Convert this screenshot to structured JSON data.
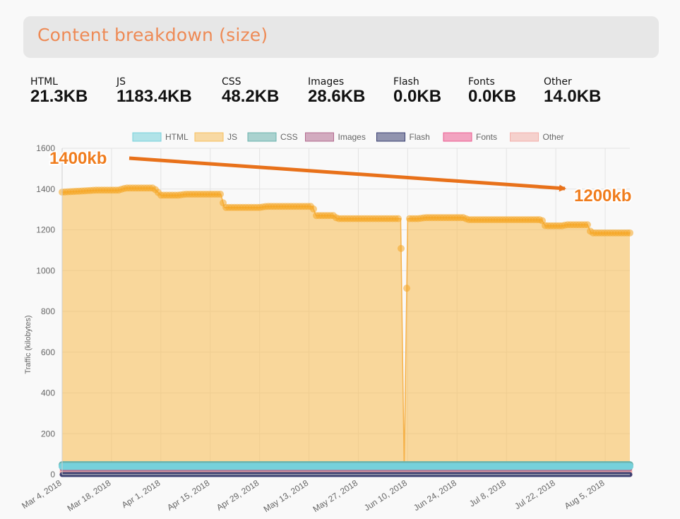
{
  "header": {
    "title": "Content breakdown (size)"
  },
  "stats": [
    {
      "label": "HTML",
      "value": "21.3KB"
    },
    {
      "label": "JS",
      "value": "1183.4KB"
    },
    {
      "label": "CSS",
      "value": "48.2KB"
    },
    {
      "label": "Images",
      "value": "28.6KB"
    },
    {
      "label": "Flash",
      "value": "0.0KB"
    },
    {
      "label": "Fonts",
      "value": "0.0KB"
    },
    {
      "label": "Other",
      "value": "14.0KB"
    }
  ],
  "chart_data": {
    "type": "area",
    "ylabel": "Traffic (kilobytes)",
    "ylim": [
      0,
      1600
    ],
    "yticks": [
      0,
      200,
      400,
      600,
      800,
      1000,
      1200,
      1400,
      1600
    ],
    "x_range": [
      "Mar 4, 2018",
      "Aug 12, 2018"
    ],
    "xticks": [
      "Mar 4, 2018",
      "Mar 18, 2018",
      "Apr 1, 2018",
      "Apr 15, 2018",
      "Apr 29, 2018",
      "May 13, 2018",
      "May 27, 2018",
      "Jun 10, 2018",
      "Jun 24, 2018",
      "Jul 8, 2018",
      "Jul 22, 2018",
      "Aug 5, 2018"
    ],
    "grid": true,
    "legend_position": "top",
    "annotations": [
      "1400kb",
      "1200kb"
    ],
    "series": [
      {
        "name": "HTML",
        "color": "#76d1db",
        "points": [
          [
            "Mar 4, 2018",
            40
          ],
          [
            "Aug 12, 2018",
            40
          ]
        ]
      },
      {
        "name": "JS",
        "color": "#f8bf5c",
        "points": [
          [
            "Mar 4, 2018",
            1385
          ],
          [
            "Mar 9, 2018",
            1390
          ],
          [
            "Mar 14, 2018",
            1395
          ],
          [
            "Mar 20, 2018",
            1395
          ],
          [
            "Mar 22, 2018",
            1405
          ],
          [
            "Mar 30, 2018",
            1405
          ],
          [
            "Apr 1, 2018",
            1370
          ],
          [
            "Apr 6, 2018",
            1370
          ],
          [
            "Apr 8, 2018",
            1375
          ],
          [
            "Apr 18, 2018",
            1375
          ],
          [
            "Apr 19, 2018",
            1310
          ],
          [
            "Apr 29, 2018",
            1310
          ],
          [
            "May 1, 2018",
            1315
          ],
          [
            "May 14, 2018",
            1315
          ],
          [
            "May 15, 2018",
            1270
          ],
          [
            "May 20, 2018",
            1270
          ],
          [
            "May 21, 2018",
            1255
          ],
          [
            "Jun 8, 2018",
            1255
          ],
          [
            "Jun 9, 2018",
            30
          ],
          [
            "Jun 10, 2018",
            1255
          ],
          [
            "Jun 13, 2018",
            1255
          ],
          [
            "Jun 15, 2018",
            1260
          ],
          [
            "Jun 26, 2018",
            1260
          ],
          [
            "Jun 27, 2018",
            1250
          ],
          [
            "Jul 18, 2018",
            1250
          ],
          [
            "Jul 19, 2018",
            1220
          ],
          [
            "Jul 24, 2018",
            1220
          ],
          [
            "Jul 25, 2018",
            1225
          ],
          [
            "Jul 31, 2018",
            1225
          ],
          [
            "Aug 1, 2018",
            1185
          ],
          [
            "Aug 12, 2018",
            1185
          ]
        ]
      },
      {
        "name": "CSS",
        "color": "#6ab3ad",
        "points": [
          [
            "Mar 4, 2018",
            48
          ],
          [
            "Aug 12, 2018",
            48
          ]
        ]
      },
      {
        "name": "Images",
        "color": "#b36b8f",
        "points": [
          [
            "Mar 4, 2018",
            28
          ],
          [
            "Aug 12, 2018",
            28
          ]
        ]
      },
      {
        "name": "Flash",
        "color": "#3c4172",
        "points": [
          [
            "Mar 4, 2018",
            0
          ],
          [
            "Aug 12, 2018",
            0
          ]
        ]
      },
      {
        "name": "Fonts",
        "color": "#ec5c91",
        "points": [
          [
            "Mar 4, 2018",
            0
          ],
          [
            "Aug 12, 2018",
            0
          ]
        ]
      },
      {
        "name": "Other",
        "color": "#f3b0aa",
        "points": [
          [
            "Mar 4, 2018",
            14
          ],
          [
            "Aug 12, 2018",
            14
          ]
        ]
      }
    ]
  }
}
